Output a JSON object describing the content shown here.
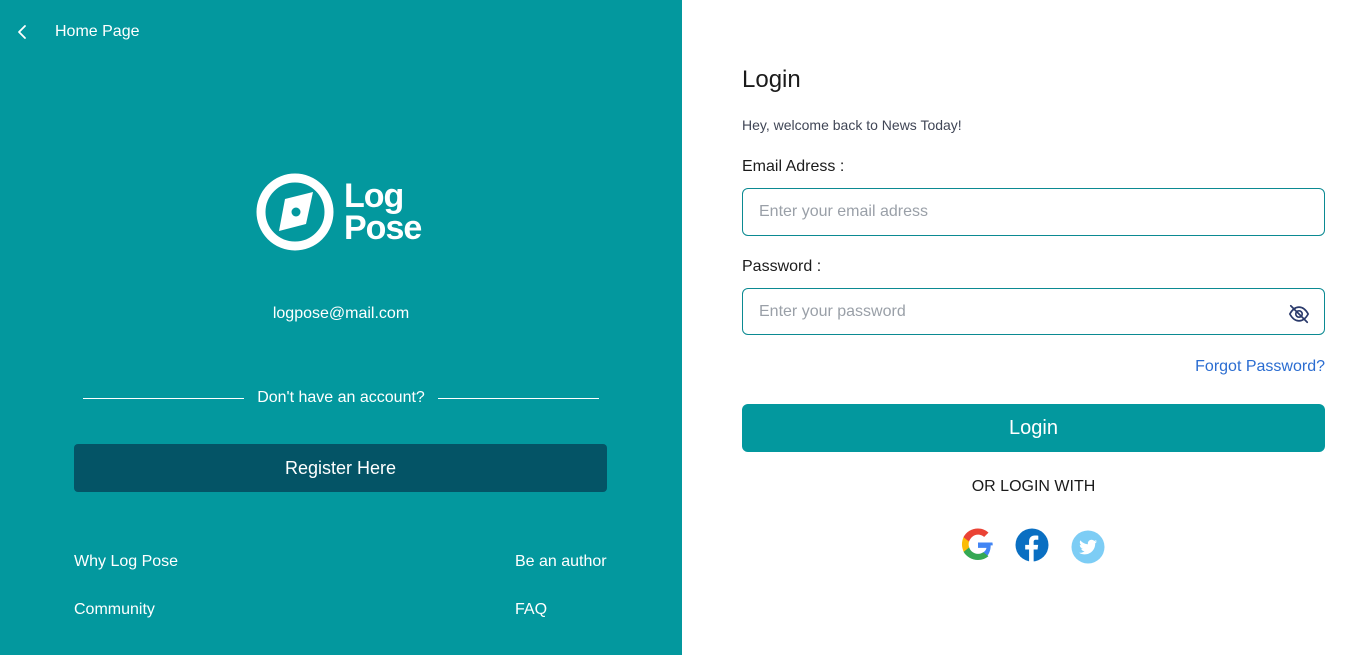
{
  "left_panel": {
    "back_label": "Home Page",
    "logo": {
      "line1": "Log",
      "line2": "Pose"
    },
    "email": "logpose@mail.com",
    "divider_text": "Don't have an account?",
    "register_label": "Register Here",
    "footer_links": [
      "Why Log Pose",
      "Be an author",
      "Community",
      "FAQ"
    ]
  },
  "login_form": {
    "title": "Login",
    "subtitle": "Hey, welcome back to News Today!",
    "email_label": "Email Adress :",
    "email_placeholder": "Enter your email adress",
    "password_label": "Password :",
    "password_placeholder": "Enter your password",
    "forgot_label": "Forgot Password?",
    "login_label": "Login",
    "or_label": "OR LOGIN WITH",
    "social": [
      "google-icon",
      "facebook-icon",
      "twitter-icon"
    ]
  },
  "colors": {
    "primary": "#03989e",
    "register_button": "#045466",
    "link": "#2b6dd1",
    "facebook": "#0a6fc2",
    "twitter": "#7dcdf5"
  }
}
